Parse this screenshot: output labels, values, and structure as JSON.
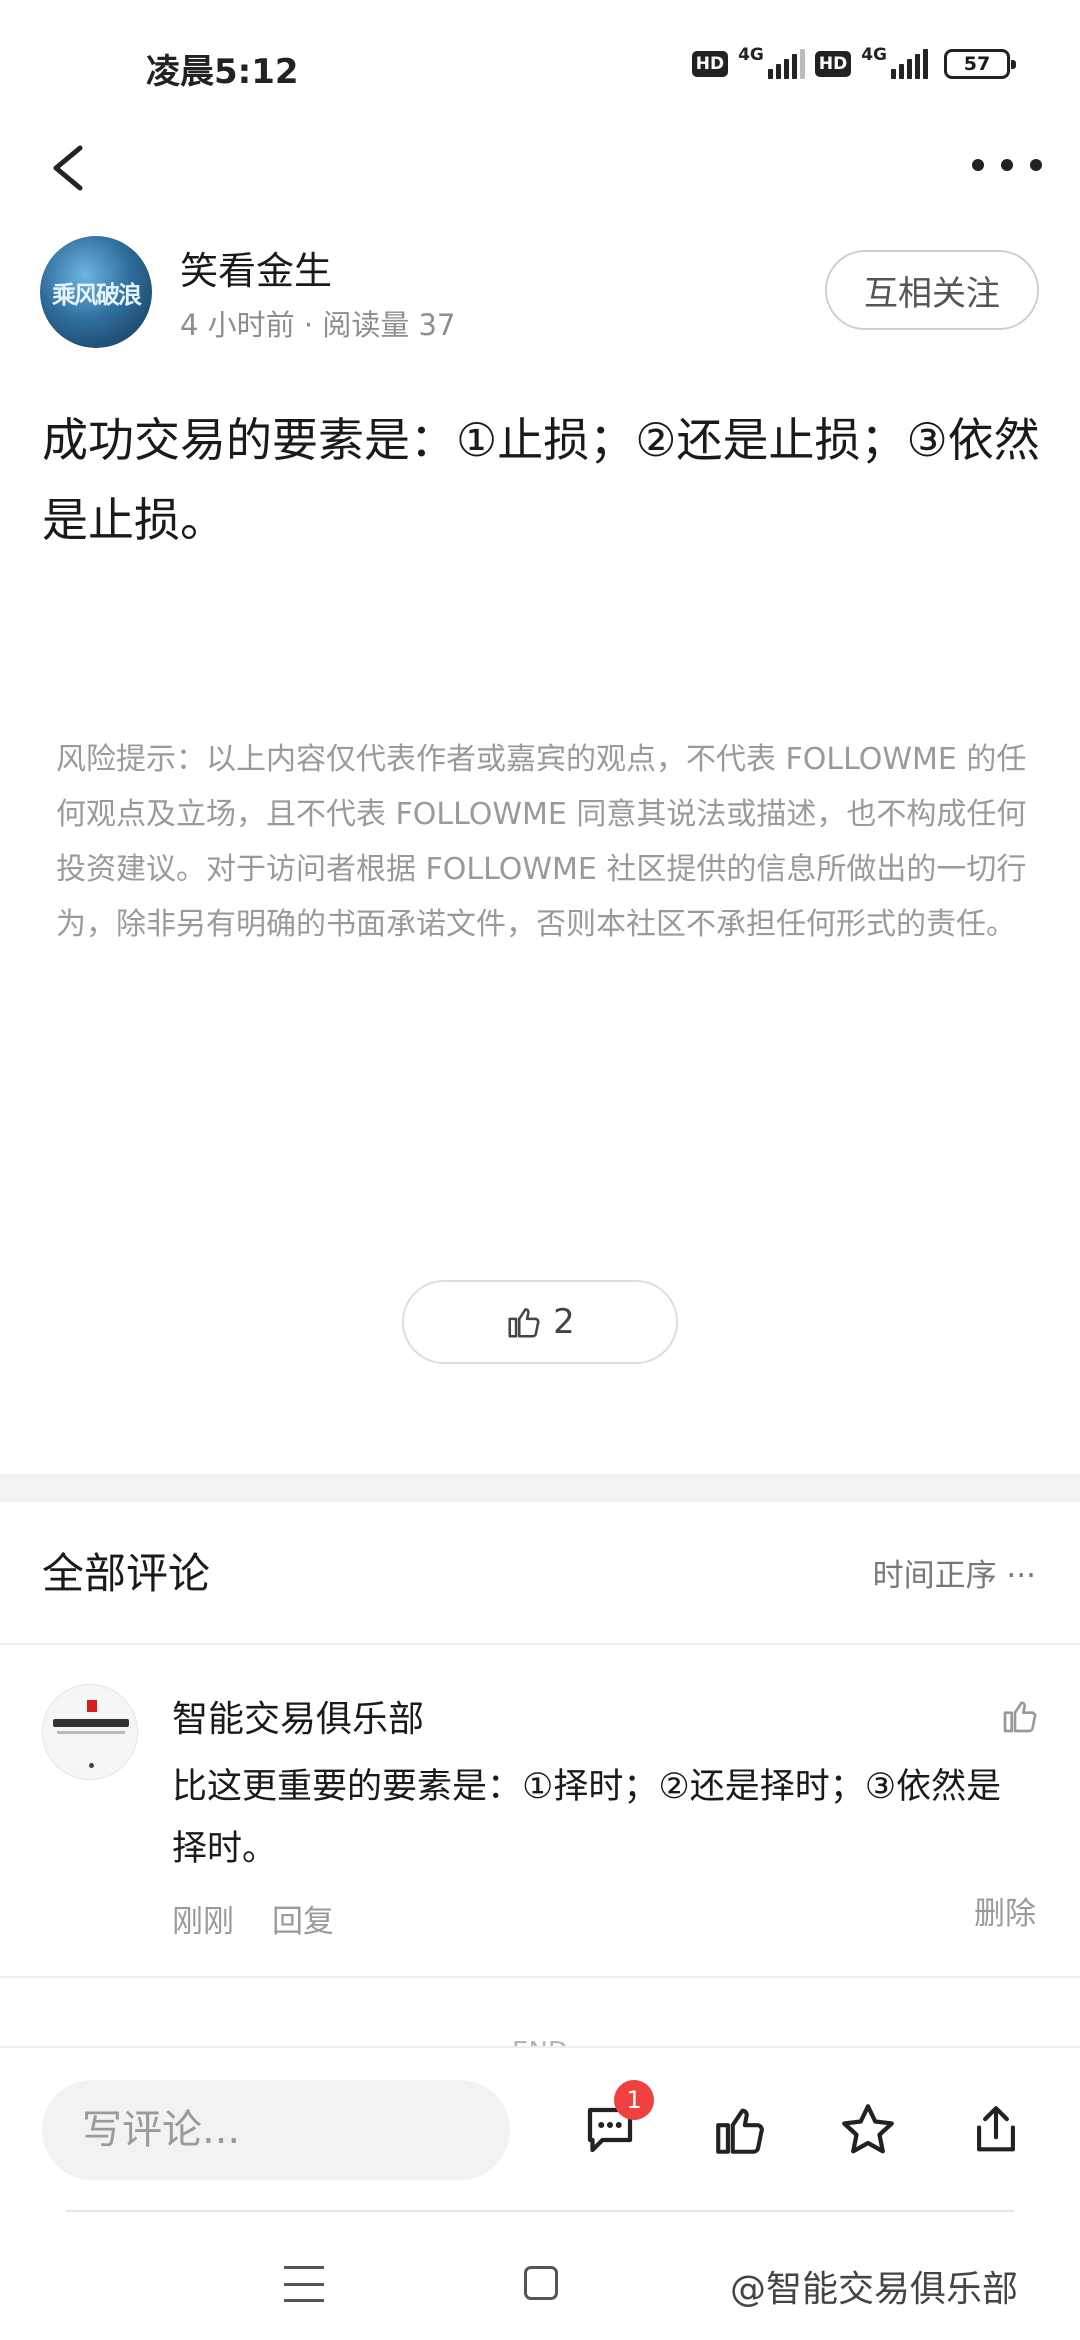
{
  "status_bar": {
    "time": "凌晨5:12",
    "hd_1": "HD",
    "network_1": "4G",
    "hd_2": "HD",
    "network_2": "4G",
    "battery": "57"
  },
  "nav": {
    "back_icon": "chevron-left-icon",
    "more_icon": "more-horizontal-icon"
  },
  "author": {
    "avatar_text": "乘风破浪",
    "name": "笑看金生",
    "meta": "4 小时前 · 阅读量 37",
    "follow_label": "互相关注"
  },
  "post": {
    "content": "成功交易的要素是：①止损；②还是止损；③依然是止损。",
    "risk_notice": "风险提示：以上内容仅代表作者或嘉宾的观点，不代表 FOLLOWME 的任何观点及立场，且不代表 FOLLOWME 同意其说法或描述，也不构成任何投资建议。对于访问者根据 FOLLOWME 社区提供的信息所做出的一切行为，除非另有明确的书面承诺文件，否则本社区不承担任何形式的责任。",
    "like_count": "2"
  },
  "comments": {
    "title": "全部评论",
    "sort_label": "时间正序 ···",
    "items": [
      {
        "name": "智能交易俱乐部",
        "text": "比这更重要的要素是：①择时；②还是择时；③依然是择时。",
        "time": "刚刚",
        "reply_label": "回复",
        "delete_label": "删除"
      }
    ],
    "end_text": "END"
  },
  "bottom_bar": {
    "comment_placeholder": "写评论...",
    "comment_badge": "1"
  },
  "system_nav": {
    "watermark": "@智能交易俱乐部"
  },
  "colors": {
    "badge": "#f04040",
    "muted_text": "#9a9a9a",
    "follow_border": "#cfcfcf"
  }
}
